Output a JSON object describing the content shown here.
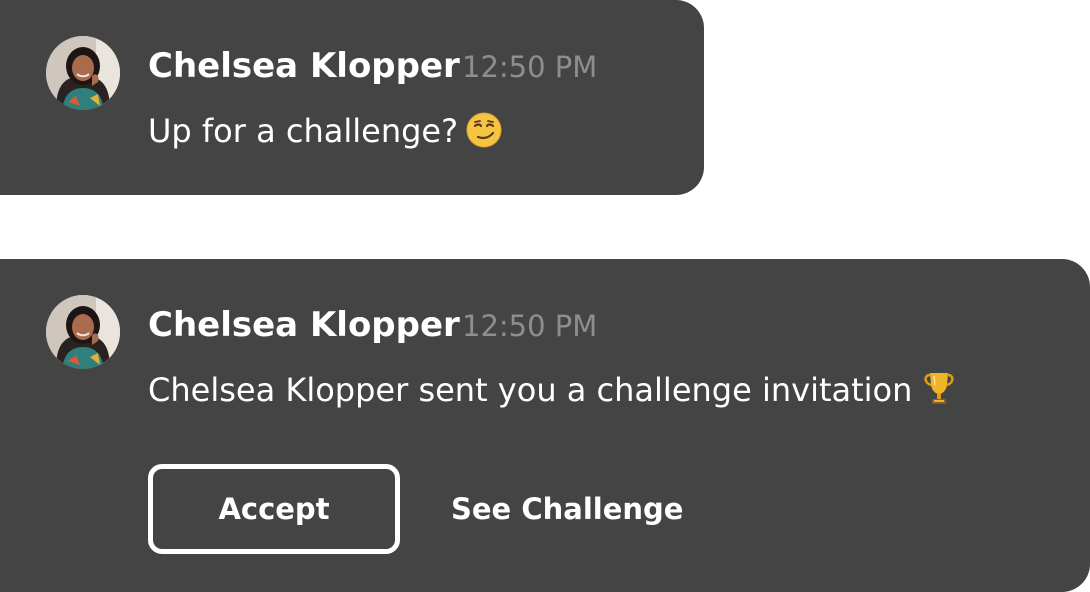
{
  "messages": [
    {
      "sender": "Chelsea Klopper",
      "time": "12:50 PM",
      "text": "Up for a challenge?",
      "emoji_icon": "smirking-face-emoji"
    },
    {
      "sender": "Chelsea Klopper",
      "time": "12:50 PM",
      "text": "Chelsea Klopper sent you a challenge invitation",
      "emoji_icon": "trophy-emoji",
      "actions": {
        "accept_label": "Accept",
        "see_challenge_label": "See Challenge"
      }
    }
  ],
  "colors": {
    "card_background": "#444444",
    "text_primary": "#ffffff",
    "timestamp": "#8e8e8e",
    "page_background": "#ffffff"
  }
}
